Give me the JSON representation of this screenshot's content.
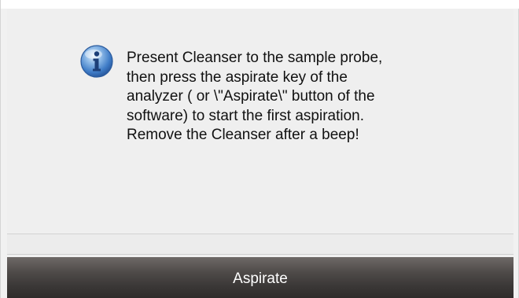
{
  "dialog": {
    "message": "Present Cleanser to the sample probe,\nthen press the aspirate key of the\nanalyzer ( or \\\"Aspirate\\\" button of the\nsoftware) to start the first aspiration.\nRemove the Cleanser after a beep!",
    "icon": "info-icon",
    "button_label": "Aspirate"
  },
  "colors": {
    "background": "#efefef",
    "button_dark": "#3b3837",
    "icon_blue": "#2f6fc4"
  }
}
